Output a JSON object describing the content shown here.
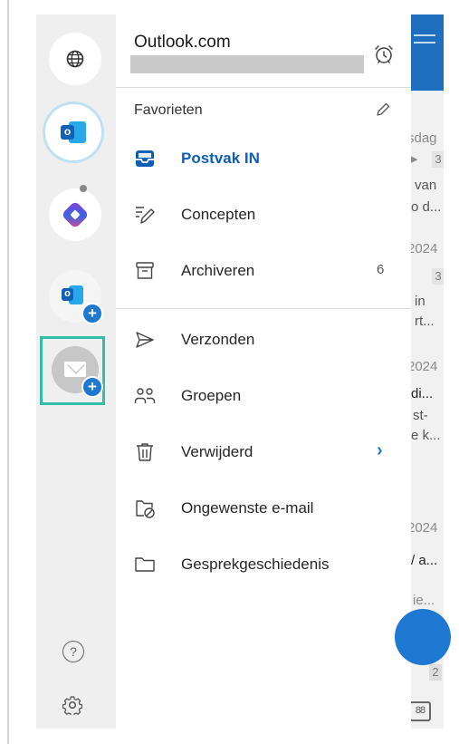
{
  "account": {
    "title": "Outlook.com"
  },
  "favorites_label": "Favorieten",
  "folders": [
    {
      "label": "Postvak IN",
      "icon": "inbox-icon",
      "active": true
    },
    {
      "label": "Concepten",
      "icon": "draft-icon"
    },
    {
      "label": "Archiveren",
      "icon": "archive-icon",
      "count": "6"
    },
    {
      "label": "Verzonden",
      "icon": "send-icon"
    },
    {
      "label": "Groepen",
      "icon": "groups-icon"
    },
    {
      "label": "Verwijderd",
      "icon": "trash-icon",
      "chevron": "›"
    },
    {
      "label": "Ongewenste e-mail",
      "icon": "junk-folder-icon"
    },
    {
      "label": "Gesprekgeschiedenis",
      "icon": "folder-icon"
    }
  ],
  "rail": {
    "help_glyph": "?",
    "add_glyph": "+",
    "outlook_letter": "o"
  },
  "background_list": {
    "lines": [
      {
        "text": "sdag"
      },
      {
        "text": "▸"
      },
      {
        "text": "van"
      },
      {
        "text": "o d..."
      },
      {
        "text": "2024"
      },
      {
        "text": "in"
      },
      {
        "text": "rt..."
      },
      {
        "text": "2024"
      },
      {
        "text": "di..."
      },
      {
        "text": "st-"
      },
      {
        "text": "e k..."
      },
      {
        "text": "2024"
      },
      {
        "text": "/ a..."
      },
      {
        "text": "ie..."
      }
    ],
    "counts": [
      "3",
      "3",
      "2"
    ]
  },
  "colors": {
    "accent": "#1e78d1",
    "active_text": "#0f5fb8",
    "highlight_frame": "#30bfa6",
    "header_blue": "#1e6fc0"
  }
}
